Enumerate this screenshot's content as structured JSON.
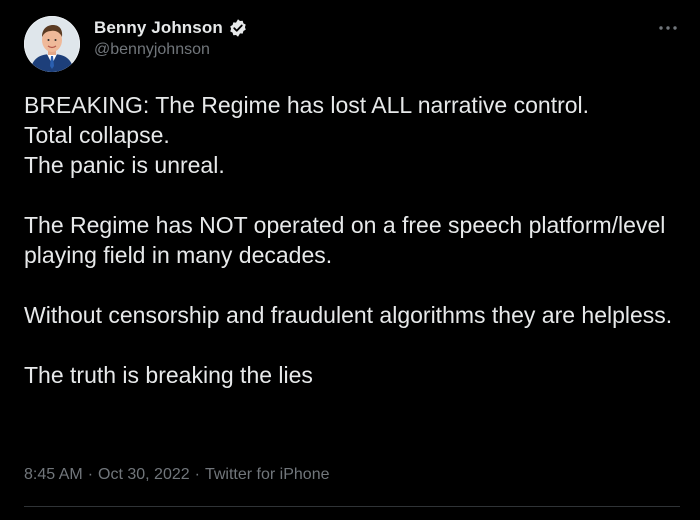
{
  "author": {
    "display_name": "Benny Johnson",
    "handle": "@bennyjohnson",
    "verified": true
  },
  "tweet": {
    "text": "BREAKING: The Regime has lost ALL narrative control.\nTotal collapse.\nThe panic is unreal.\n\nThe Regime has NOT operated on a free speech platform/level playing field in many decades.\n\nWithout censorship and fraudulent algorithms they are helpless.\n\nThe truth is breaking the lies",
    "time": "8:45 AM",
    "date": "Oct 30, 2022",
    "source": "Twitter for iPhone",
    "separator": "·"
  },
  "icons": {
    "more": "more-options-icon",
    "verified": "verified-badge-icon"
  },
  "colors": {
    "background": "#000000",
    "text": "#e7e9ea",
    "secondary": "#71767b",
    "verified": "#e7e9ea"
  }
}
